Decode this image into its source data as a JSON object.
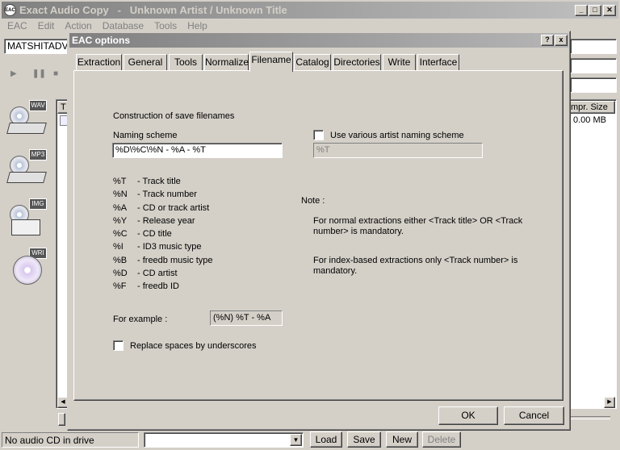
{
  "window": {
    "title": "Exact Audio Copy   -   Unknown Artist / Unknown Title"
  },
  "menu": [
    "EAC",
    "Edit",
    "Action",
    "Database",
    "Tools",
    "Help"
  ],
  "drive_field": "MATSHITADVD",
  "left_icons": [
    "WAV",
    "MP3",
    "IMG",
    "WRI"
  ],
  "bg_table": {
    "col_t": "T",
    "col_size": "mpr. Size",
    "size_value": "0.00 MB"
  },
  "status": {
    "text": "No audio CD in drive",
    "buttons": {
      "load": "Load",
      "save": "Save",
      "new": "New",
      "delete": "Delete"
    }
  },
  "dialog": {
    "title": "EAC options",
    "help_btn": "?",
    "close_btn": "x",
    "tabs": [
      "Extraction",
      "General",
      "Tools",
      "Normalize",
      "Filename",
      "Catalog",
      "Directories",
      "Write",
      "Interface"
    ],
    "active_tab": "Filename",
    "section_title": "Construction of save filenames",
    "naming_label": "Naming scheme",
    "naming_value": "%D\\%C\\%N - %A - %T",
    "various_label": "Use various artist naming scheme",
    "various_value": "%T",
    "placeholders": [
      {
        "code": "%T",
        "desc": "- Track title"
      },
      {
        "code": "%N",
        "desc": "- Track number"
      },
      {
        "code": "%A",
        "desc": "- CD or track artist"
      },
      {
        "code": "%Y",
        "desc": "- Release year"
      },
      {
        "code": "%C",
        "desc": "- CD title"
      },
      {
        "code": "%I",
        "desc": "- ID3 music type"
      },
      {
        "code": "%B",
        "desc": "- freedb music type"
      },
      {
        "code": "%D",
        "desc": "- CD artist"
      },
      {
        "code": "%F",
        "desc": "- freedb ID"
      }
    ],
    "note_label": "Note :",
    "note1": "For normal extractions either <Track title>  OR  <Track number> is mandatory.",
    "note2": "For index-based extractions only <Track number> is mandatory.",
    "example_label": "For example :",
    "example_value": "(%N) %T - %A",
    "replace_label": "Replace spaces by underscores",
    "ok": "OK",
    "cancel": "Cancel"
  }
}
